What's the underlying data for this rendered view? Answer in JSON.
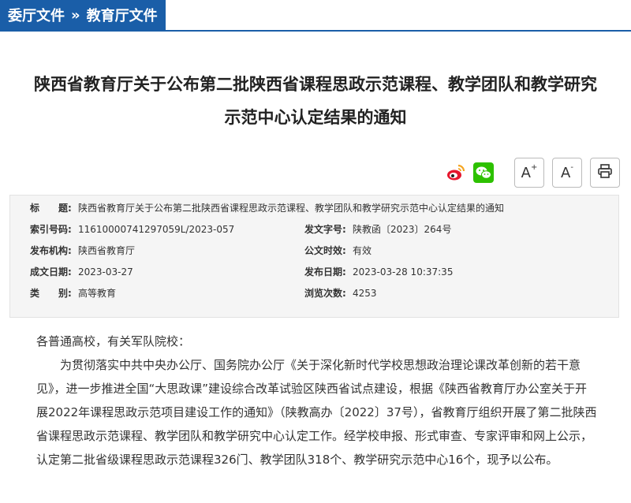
{
  "breadcrumb": {
    "item1": "委厅文件",
    "separator": "»",
    "item2": "教育厅文件"
  },
  "title": {
    "line1": "陕西省教育厅关于公布第二批陕西省课程思政示范课程、教学团队和教学研究",
    "line2": "示范中心认定结果的通知"
  },
  "tools": {
    "font_larger": "A",
    "font_larger_sup": "+",
    "font_smaller": "A",
    "font_smaller_sup": "-"
  },
  "meta": {
    "title_label": "标　　题:",
    "title_value": "陕西省教育厅关于公布第二批陕西省课程思政示范课程、教学团队和教学研究示范中心认定结果的通知",
    "index_label": "索引号码:",
    "index_value": "11610000741297059L/2023-057",
    "docno_label": "发文字号:",
    "docno_value": "陕教函〔2023〕264号",
    "org_label": "发布机构:",
    "org_value": "陕西省教育厅",
    "validity_label": "公文时效:",
    "validity_value": "有效",
    "created_label": "成文日期:",
    "created_value": "2023-03-27",
    "published_label": "发布日期:",
    "published_value": "2023-03-28 10:37:35",
    "category_label": "类　　别:",
    "category_value": "高等教育",
    "views_label": "浏览次数:",
    "views_value": "4253"
  },
  "body": {
    "salutation": "各普通高校，有关军队院校：",
    "paragraph": "为贯彻落实中共中央办公厅、国务院办公厅《关于深化新时代学校思想政治理论课改革创新的若干意见》，进一步推进全国“大思政课”建设综合改革试验区陕西省试点建设，根据《陕西省教育厅办公室关于开展2022年课程思政示范项目建设工作的通知》（陕教高办〔2022〕37号），省教育厅组织开展了第二批陕西省课程思政示范课程、教学团队和教学研究中心认定工作。经学校申报、形式审查、专家评审和网上公示，认定第二批省级课程思政示范课程326门、教学团队318个、教学研究示范中心16个，现予以公布。"
  },
  "colors": {
    "brand_blue": "#1a5ea8",
    "weibo_red": "#e6162d",
    "wechat_green": "#2dc100"
  },
  "icons": [
    "weibo-icon",
    "wechat-icon",
    "print-icon"
  ]
}
